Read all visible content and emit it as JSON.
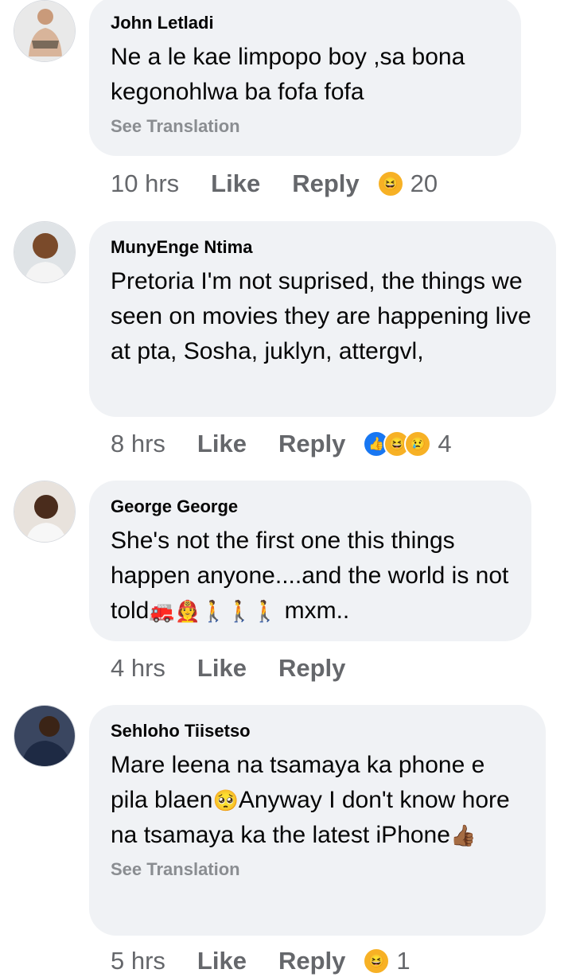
{
  "comments": [
    {
      "author": "John Letladi",
      "text": "Ne a le kae limpopo boy ,sa bona kegonohlwa ba fofa fofa",
      "see_translation": "See Translation",
      "time": "10 hrs",
      "like_label": "Like",
      "reply_label": "Reply",
      "reactions": [
        "haha"
      ],
      "reaction_count": "20"
    },
    {
      "author": "MunyEnge Ntima",
      "text": "Pretoria I'm not suprised, the things we seen on movies they are happening live at pta, Sosha, juklyn, attergvl,",
      "time": "8 hrs",
      "like_label": "Like",
      "reply_label": "Reply",
      "reactions": [
        "like",
        "haha",
        "sad"
      ],
      "reaction_count": "4"
    },
    {
      "author": "George George",
      "text_main": "She's not the first one this things happen anyone....and the world is not told",
      "text_emojis": "🚒🧑‍🚒🚶🚶🚶",
      "text_tail": "mxm..",
      "time": "4 hrs",
      "like_label": "Like",
      "reply_label": "Reply"
    },
    {
      "author": "Sehloho Tiisetso",
      "text_a": "Mare leena na tsamaya ka phone e pila blaen",
      "emoji_a": "🥺",
      "text_b": "Anyway I don't know hore na tsamaya ka the latest iPhone",
      "emoji_b": "👍🏾",
      "see_translation": "See Translation",
      "time": "5 hrs",
      "like_label": "Like",
      "reply_label": "Reply",
      "reactions": [
        "haha"
      ],
      "reaction_count": "1"
    }
  ],
  "colors": {
    "bubble": "#f0f2f5",
    "secondary_text": "#65676b",
    "like_blue": "#1877f2",
    "reaction_yellow": "#f7b125"
  }
}
